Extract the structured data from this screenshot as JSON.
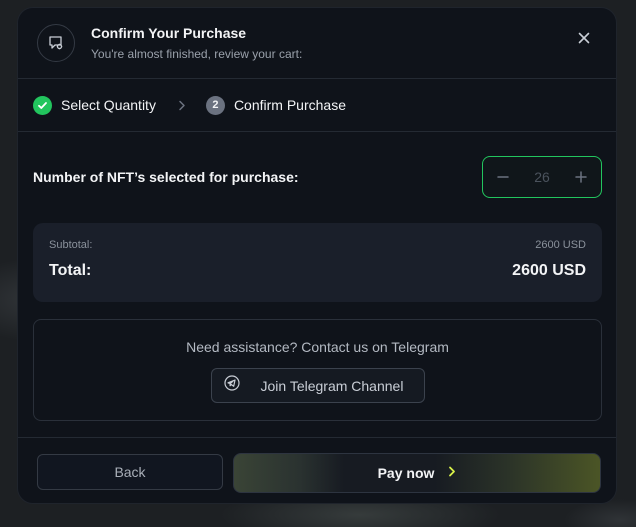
{
  "header": {
    "title": "Confirm Your Purchase",
    "subtitle": "You're almost finished, review your cart:"
  },
  "steps": [
    {
      "label": "Select Quantity",
      "state": "done",
      "icon": "check-icon"
    },
    {
      "label": "Confirm Purchase",
      "state": "active",
      "number": "2"
    }
  ],
  "quantity": {
    "label": "Number of NFT’s selected for purchase:",
    "value": "26"
  },
  "summary": {
    "subtotal_label": "Subtotal:",
    "subtotal_value": "2600 USD",
    "total_label": "Total:",
    "total_value": "2600 USD"
  },
  "assistance": {
    "text": "Need assistance? Contact us on Telegram",
    "button_label": "Join Telegram Channel",
    "button_icon": "telegram-icon"
  },
  "footer": {
    "back_label": "Back",
    "pay_label": "Pay now",
    "pay_icon": "chevron-right-icon"
  },
  "colors": {
    "accent_green": "#22c55e",
    "pay_arrow": "#d9f24a",
    "modal_bg": "#0f131a",
    "card_bg": "#1a1f2a"
  }
}
